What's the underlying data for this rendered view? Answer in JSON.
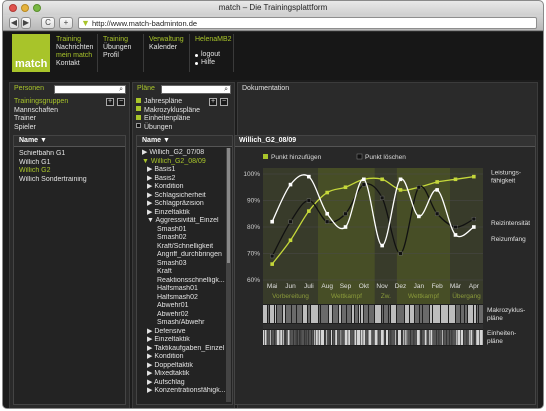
{
  "window": {
    "title": "match – Die Trainingsplattform"
  },
  "browser": {
    "url": "http://www.match-badminton.de",
    "back": "◀",
    "forward": "▶",
    "reload": "C",
    "add": "+"
  },
  "logo": "match",
  "nav": {
    "col1": [
      "Training",
      "Nachrichten",
      "mein match",
      "Kontakt"
    ],
    "col2": [
      "Training",
      "Übungen",
      "Profil"
    ],
    "col3": [
      "Verwaltung",
      "Kalender"
    ],
    "col4_title": "HelenaMB2",
    "logout": "logout",
    "help": "Hilfe"
  },
  "personen": {
    "title": "Personen",
    "filters": [
      "Trainingsgruppen",
      "Mannschaften",
      "Trainer",
      "Spieler"
    ],
    "list_header": "Name ▼",
    "items": [
      "Schiefbahn G1",
      "Willich G1",
      "Willich G2",
      "Willich Sondertraining"
    ],
    "selected_index": 2
  },
  "plaene": {
    "title": "Pläne",
    "filters": [
      "Jahrespläne",
      "Makrozykluspläne",
      "Einheitenpläne",
      "Übungen"
    ],
    "filter_checked": [
      true,
      true,
      true,
      false
    ],
    "list_header": "Name ▼",
    "tree": [
      {
        "label": "▶ Willich_G2_07/08",
        "indent": 0,
        "sel": false
      },
      {
        "label": "▼ Willich_G2_08/09",
        "indent": 0,
        "sel": true
      },
      {
        "label": "▶ Basis1",
        "indent": 1,
        "sel": false
      },
      {
        "label": "▶ Basis2",
        "indent": 1,
        "sel": false
      },
      {
        "label": "▶ Kondition",
        "indent": 1,
        "sel": false
      },
      {
        "label": "▶ Schlagsicherheit",
        "indent": 1,
        "sel": false
      },
      {
        "label": "▶ Schlagpräzision",
        "indent": 1,
        "sel": false
      },
      {
        "label": "▶ Einzeltaktik",
        "indent": 1,
        "sel": false
      },
      {
        "label": "▼ Aggressivität_Einzel",
        "indent": 1,
        "sel": false
      },
      {
        "label": "Smash01",
        "indent": 3,
        "sel": false
      },
      {
        "label": "Smash02",
        "indent": 3,
        "sel": false
      },
      {
        "label": "Kraft/Schnelligkeit",
        "indent": 3,
        "sel": false
      },
      {
        "label": "Angriff_durchbringen",
        "indent": 3,
        "sel": false
      },
      {
        "label": "Smash03",
        "indent": 3,
        "sel": false
      },
      {
        "label": "Kraft",
        "indent": 3,
        "sel": false
      },
      {
        "label": "Reaktionsschnelligk...",
        "indent": 3,
        "sel": false
      },
      {
        "label": "Halfsmash01",
        "indent": 3,
        "sel": false
      },
      {
        "label": "Halfsmash02",
        "indent": 3,
        "sel": false
      },
      {
        "label": "Abwehr01",
        "indent": 3,
        "sel": false
      },
      {
        "label": "Abwehr02",
        "indent": 3,
        "sel": false
      },
      {
        "label": "Smash/Abwehr",
        "indent": 3,
        "sel": false
      },
      {
        "label": "▶ Defensive",
        "indent": 1,
        "sel": false
      },
      {
        "label": "▶ Einzeltaktik",
        "indent": 1,
        "sel": false
      },
      {
        "label": "▶ Taktikaufgaben_Einzel",
        "indent": 1,
        "sel": false
      },
      {
        "label": "▶ Kondition",
        "indent": 1,
        "sel": false
      },
      {
        "label": "▶ Doppeltaktik",
        "indent": 1,
        "sel": false
      },
      {
        "label": "▶ Mixedtaktik",
        "indent": 1,
        "sel": false
      },
      {
        "label": "▶ Aufschlag",
        "indent": 1,
        "sel": false
      },
      {
        "label": "▶ Konzentrationsfähigk...",
        "indent": 1,
        "sel": false
      }
    ]
  },
  "doku": {
    "title": "Dokumentation",
    "chart_title": "Willich_G2_08/09",
    "add_point": "Punkt hinzufügen",
    "delete_point": "Punkt löschen",
    "macro_label": "Makrozyklus-\npläne",
    "unit_label": "Einheiten-\npläne"
  },
  "colors": {
    "accent": "#a8c42a",
    "background": "#1c1c1c"
  },
  "chart_data": {
    "type": "line",
    "x": [
      "Mai",
      "Jun",
      "Juli",
      "Aug",
      "Sep",
      "Okt",
      "Nov",
      "Dez",
      "Jan",
      "Feb",
      "Mär",
      "Apr"
    ],
    "ylim": [
      60,
      100
    ],
    "yticks": [
      "100%",
      "90%",
      "80%",
      "70%",
      "60%"
    ],
    "phases": [
      {
        "label": "Vorbereitung",
        "from": 0,
        "to": 3
      },
      {
        "label": "Wettkampf",
        "from": 3,
        "to": 6.1
      },
      {
        "label": "Zw.",
        "from": 6.1,
        "to": 7.3
      },
      {
        "label": "Wettkampf",
        "from": 7.3,
        "to": 10.2
      },
      {
        "label": "Übergang",
        "from": 10.2,
        "to": 12
      }
    ],
    "series": [
      {
        "name": "Leistungs-\nfähigkeit",
        "color": "#c5d83a",
        "values": [
          66,
          75,
          86,
          93,
          95,
          98,
          98,
          94,
          95,
          97,
          98,
          99
        ]
      },
      {
        "name": "Reizintensität",
        "color": "#111111",
        "values": [
          69,
          82,
          90,
          82,
          85,
          96,
          91,
          70,
          95,
          85,
          80,
          83
        ]
      },
      {
        "name": "Reizumfang",
        "color": "#ffffff",
        "values": [
          82,
          96,
          99,
          85,
          80,
          98,
          73,
          98,
          84,
          94,
          77,
          80
        ]
      }
    ]
  }
}
